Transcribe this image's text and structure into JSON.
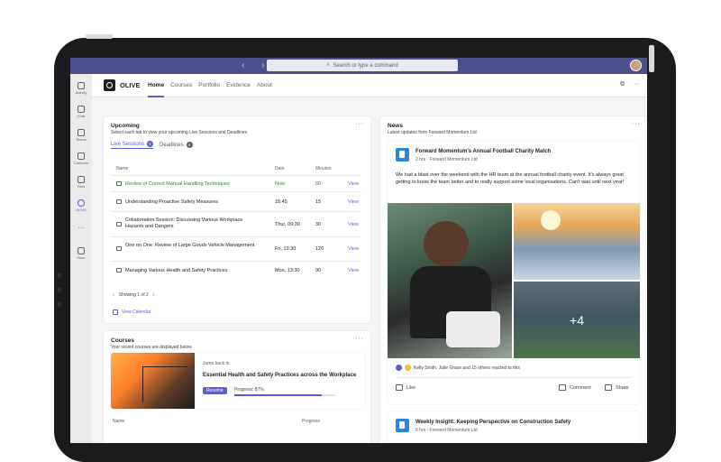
{
  "search": {
    "placeholder": "Search or type a command"
  },
  "rail": [
    {
      "label": "Activity",
      "icon": "bell-icon"
    },
    {
      "label": "Chat",
      "icon": "chat-icon"
    },
    {
      "label": "Teams",
      "icon": "teams-icon"
    },
    {
      "label": "Calendar",
      "icon": "calendar-icon"
    },
    {
      "label": "Files",
      "icon": "file-icon"
    },
    {
      "label": "OLIVE",
      "icon": "olive-icon"
    },
    {
      "label": "...",
      "icon": "more-icon"
    },
    {
      "label": "Store",
      "icon": "store-icon"
    }
  ],
  "app": {
    "name": "OLIVE",
    "tabs": [
      "Home",
      "Courses",
      "Portfolio",
      "Evidence",
      "About"
    ],
    "active_tab": "Home"
  },
  "upcoming": {
    "title": "Upcoming",
    "subtitle": "Select each tab to view your upcoming Live Sessions and Deadlines",
    "tabs": [
      {
        "label": "Live Sessions",
        "count": "5"
      },
      {
        "label": "Deadlines",
        "count": "4"
      }
    ],
    "columns": {
      "name": "Name",
      "date": "Date",
      "minutes": "Minutes"
    },
    "rows": [
      {
        "name": "Review of Correct Manual Handling Techniques",
        "date": "Now",
        "minutes": "60",
        "action": "View"
      },
      {
        "name": "Understanding Proactive Safety Measures",
        "date": "15:45",
        "minutes": "15",
        "action": "View"
      },
      {
        "name": "Collaboration Session: Discussing Various Workplace Hazards and Dangers",
        "date": "Thur, 09:30",
        "minutes": "30",
        "action": "View"
      },
      {
        "name": "One on One: Review of Large Goods Vehicle Management",
        "date": "Fri, 13:30",
        "minutes": "120",
        "action": "View"
      },
      {
        "name": "Managing Various Health and Safety Practices",
        "date": "Mon, 13:30",
        "minutes": "90",
        "action": "View"
      }
    ],
    "pager": "Showing 1 of 2",
    "view_calendar": "View Calendar"
  },
  "courses": {
    "title": "Courses",
    "subtitle": "Your recent courses are displayed below",
    "jump_back": "Jump back in",
    "course_title": "Essential Health and Safety Practices across the Workplace",
    "resume": "Resume",
    "progress_label": "Progress: 87%",
    "progress": 0.87,
    "columns": {
      "name": "Name",
      "progress": "Progress"
    }
  },
  "news": {
    "title": "News",
    "subtitle": "Latest updates from Forward Momentum Ltd",
    "posts": [
      {
        "title": "Forward Momentum's Annual Football Charity Match",
        "meta": "2 hrs · Forward Momentum Ltd",
        "body": "We had a blast over the weekend with the HR team at the annual football charity event. It's always great getting to know the team better and to really support some local organisations. Can't wait until next year!",
        "more_photos": "+4",
        "reactions": "Kelly Smith, Julie Grace and 15 others reacted to this",
        "like": "Like",
        "comment": "Comment",
        "share": "Share"
      },
      {
        "title": "Weekly Insight: Keeping Perspective on Construction Safety",
        "meta": "6 hrs · Forward Momentum Ltd"
      }
    ]
  },
  "colors": {
    "accent": "#5b5fc7",
    "topbar": "#4b4f8c",
    "now": "#2a8a2a"
  }
}
